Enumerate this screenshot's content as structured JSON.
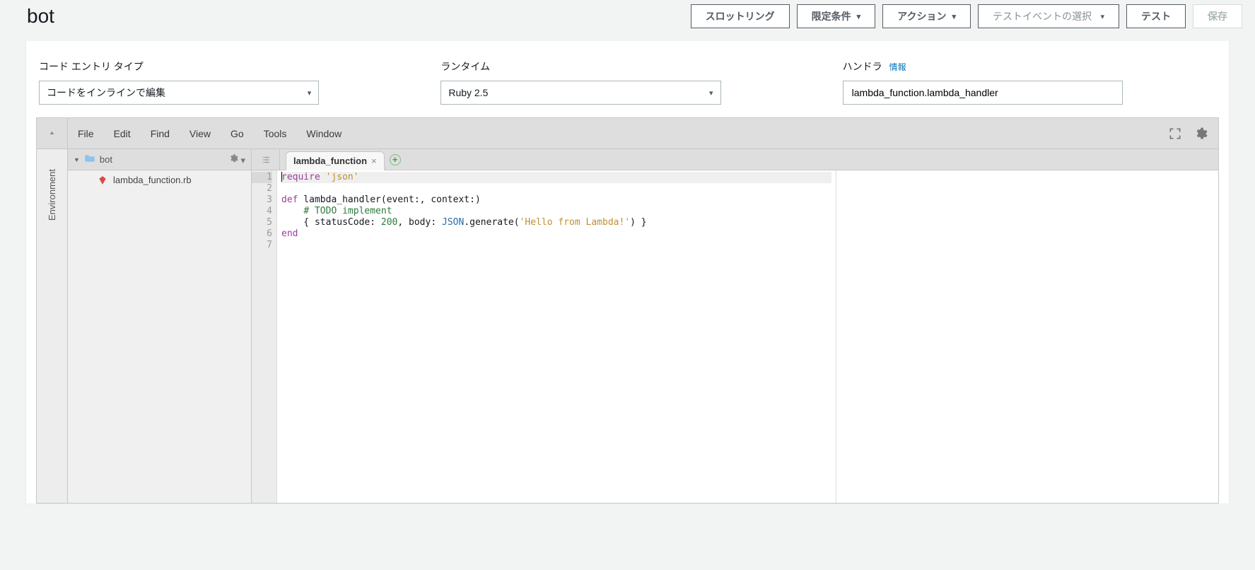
{
  "header": {
    "title": "bot",
    "buttons": {
      "throttling": "スロットリング",
      "qualifiers": "限定条件",
      "actions": "アクション",
      "test_event_placeholder": "テストイベントの選択",
      "test": "テスト",
      "save": "保存"
    }
  },
  "config": {
    "entry_type_label": "コード エントリ タイプ",
    "entry_type_value": "コードをインラインで編集",
    "runtime_label": "ランタイム",
    "runtime_value": "Ruby 2.5",
    "handler_label": "ハンドラ",
    "handler_info": "情報",
    "handler_value": "lambda_function.lambda_handler"
  },
  "editor": {
    "sidebar_label": "Environment",
    "menu": [
      "File",
      "Edit",
      "Find",
      "View",
      "Go",
      "Tools",
      "Window"
    ],
    "tree": {
      "root": "bot",
      "file": "lambda_function.rb"
    },
    "tab_name": "lambda_function",
    "code": {
      "l1_require": "require",
      "l1_json": "'json'",
      "l3_def": "def",
      "l3_sig": " lambda_handler(event:, context:)",
      "l4_comment": "# TODO implement",
      "l5_a": "    { statusCode: ",
      "l5_num": "200",
      "l5_b": ", body: ",
      "l5_json": "JSON",
      "l5_c": ".generate(",
      "l5_str": "'Hello from Lambda!'",
      "l5_d": ") }",
      "l6_end": "end"
    },
    "line_numbers": [
      "1",
      "2",
      "3",
      "4",
      "5",
      "6",
      "7"
    ]
  }
}
